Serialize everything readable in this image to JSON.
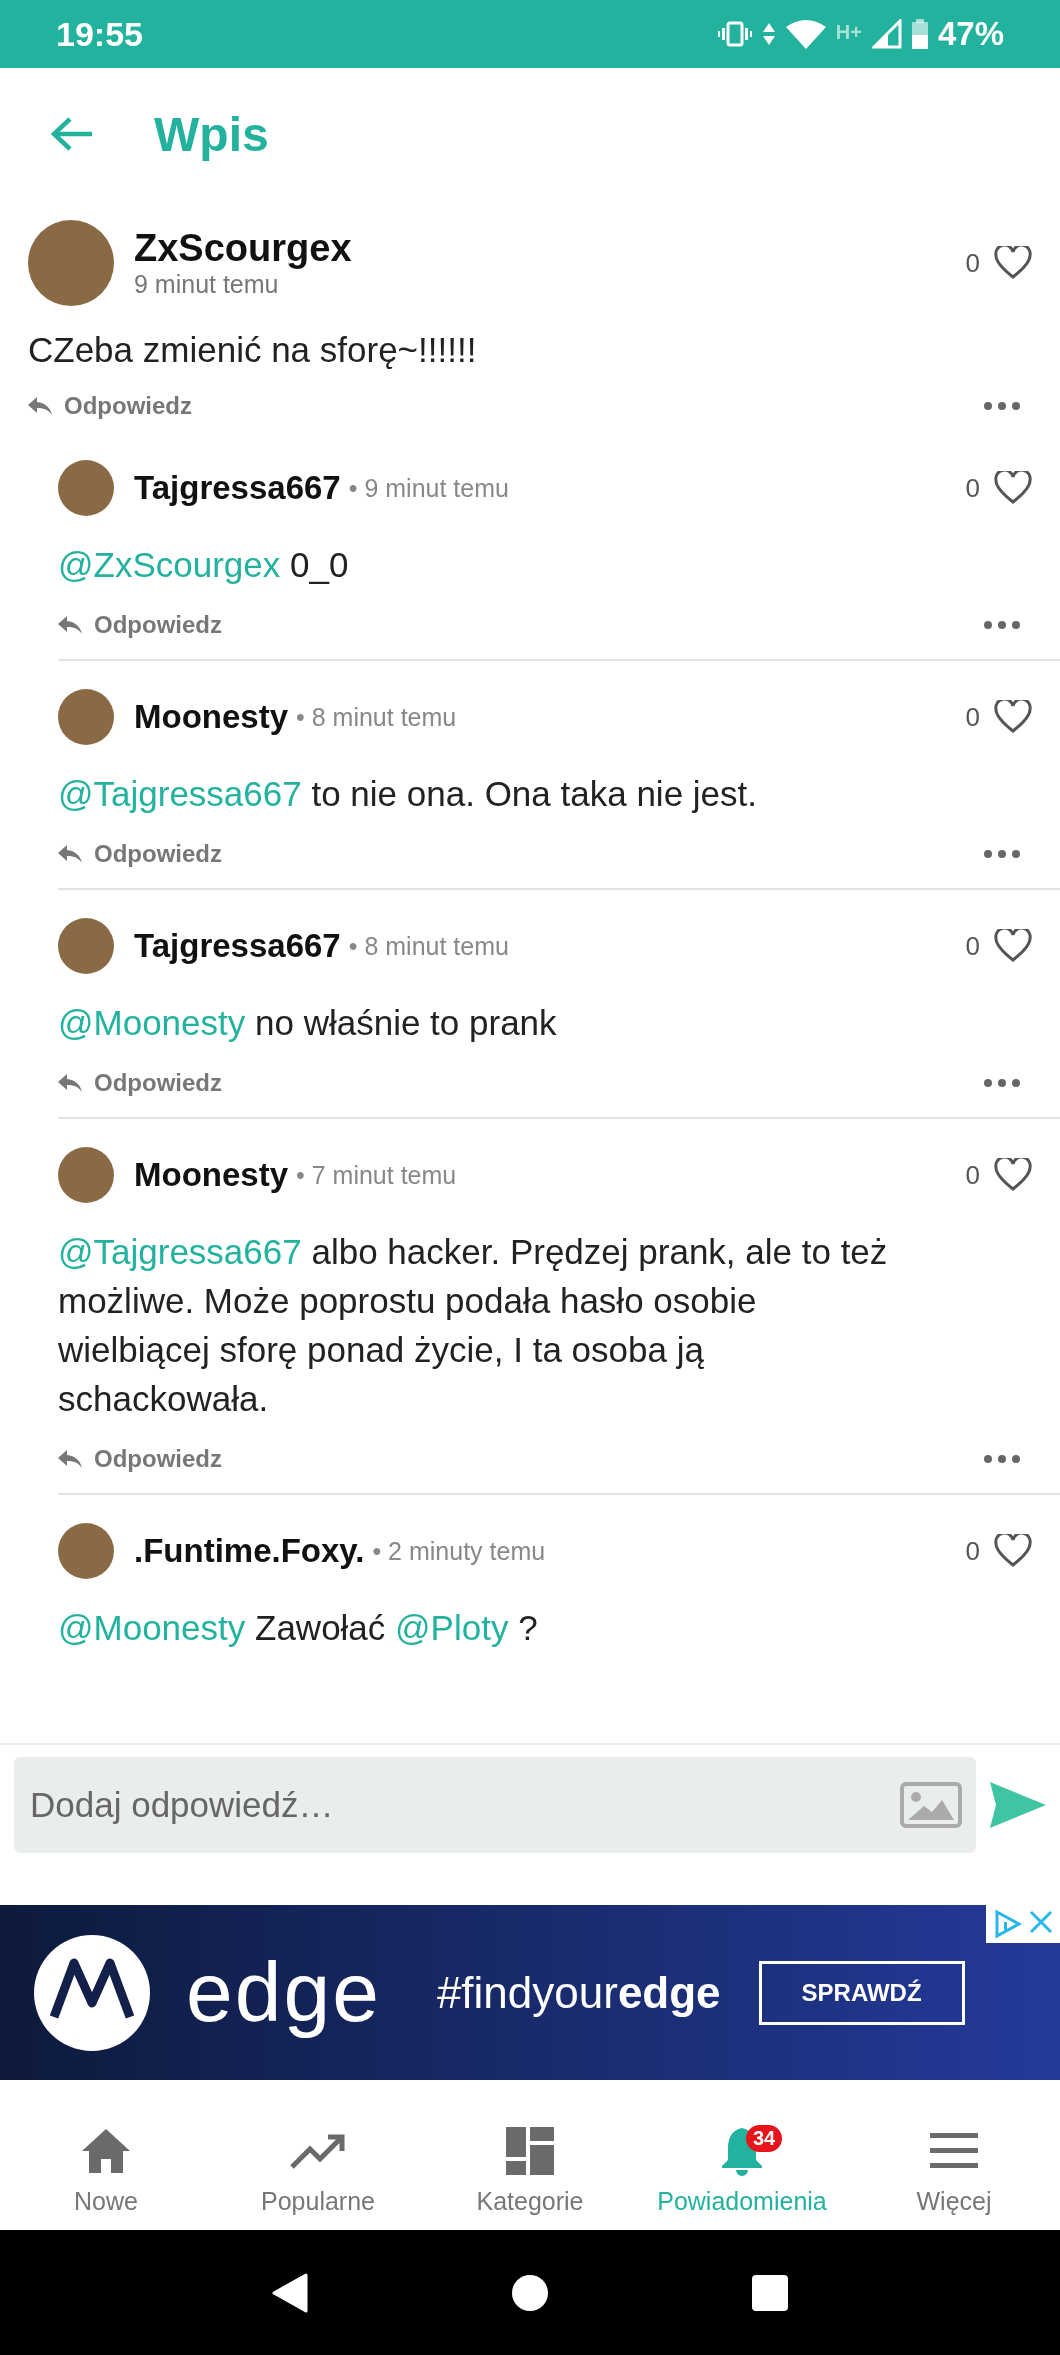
{
  "status_bar": {
    "time": "19:55",
    "network": "H+",
    "battery": "47%"
  },
  "header": {
    "title": "Wpis"
  },
  "post": {
    "author": "ZxScourgex",
    "time": "9 minut temu",
    "likes": "0",
    "text": "CZeba zmienić na sforę~!!!!!!",
    "reply": "Odpowiedz"
  },
  "comments": [
    {
      "author": "Tajgressa667",
      "time": "• 9 minut temu",
      "likes": "0",
      "segments": [
        {
          "kind": "mention",
          "text": "@ZxScourgex"
        },
        {
          "kind": "text",
          "text": " 0_0"
        }
      ],
      "reply": "Odpowiedz"
    },
    {
      "author": "Moonesty",
      "time": "• 8 minut temu",
      "likes": "0",
      "segments": [
        {
          "kind": "mention",
          "text": "@Tajgressa667"
        },
        {
          "kind": "text",
          "text": " to nie ona. Ona taka nie jest."
        }
      ],
      "reply": "Odpowiedz"
    },
    {
      "author": "Tajgressa667",
      "time": "• 8 minut temu",
      "likes": "0",
      "segments": [
        {
          "kind": "mention",
          "text": "@Moonesty"
        },
        {
          "kind": "text",
          "text": " no właśnie to prank"
        }
      ],
      "reply": "Odpowiedz"
    },
    {
      "author": "Moonesty",
      "time": "• 7 minut temu",
      "likes": "0",
      "segments": [
        {
          "kind": "mention",
          "text": "@Tajgressa667"
        },
        {
          "kind": "text",
          "text": " albo hacker. Prędzej prank, ale to też możliwe. Może poprostu podała hasło osobie wielbiącej sforę ponad życie, I ta osoba ją schackowała."
        }
      ],
      "reply": "Odpowiedz"
    },
    {
      "author": ".Funtime.Foxy.",
      "time": "• 2 minuty temu",
      "likes": "0",
      "segments": [
        {
          "kind": "mention",
          "text": "@Moonesty"
        },
        {
          "kind": "text",
          "text": " Zawołać "
        },
        {
          "kind": "mention",
          "text": "@Ploty"
        },
        {
          "kind": "text",
          "text": " ?"
        }
      ]
    }
  ],
  "composer": {
    "placeholder": "Dodaj odpowiedź…"
  },
  "ad": {
    "brand": "edge",
    "slogan": "#findyour**edge**",
    "button": "SPRAWDŹ"
  },
  "nav": [
    {
      "label": "Nowe",
      "selected": false
    },
    {
      "label": "Popularne",
      "selected": false
    },
    {
      "label": "Kategorie",
      "selected": false
    },
    {
      "label": "Powiadomienia",
      "selected": true,
      "badge": "34"
    },
    {
      "label": "Więcej",
      "selected": false
    }
  ]
}
